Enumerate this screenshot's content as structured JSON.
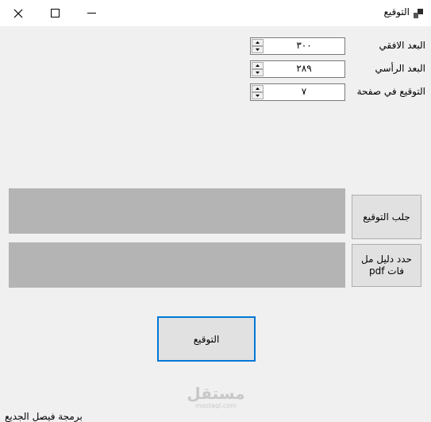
{
  "window": {
    "title": "التوقيع",
    "controls": [
      "close-icon",
      "maximize-icon",
      "minimize-icon",
      "app-icon"
    ]
  },
  "fields": [
    {
      "label": "البعد الافقي",
      "value": "٣٠٠"
    },
    {
      "label": "البعد الرأسي",
      "value": "٢٨٩"
    },
    {
      "label": "التوقيع في صفحة",
      "value": "٧"
    }
  ],
  "buttons": {
    "fetch_signature": "جلب التوقيع",
    "select_pdf_dir": "حدد دليل مل فات pdf",
    "sign": "التوقيع"
  },
  "watermark": {
    "main": "مستقل",
    "sub": "mostaql.com"
  },
  "footer": {
    "text": "برمجة فيصل الجديع"
  },
  "colors": {
    "panel": "#b4b4b4",
    "button": "#e1e1e1",
    "focus_border": "#0078d7",
    "background": "#f0f0f0"
  }
}
